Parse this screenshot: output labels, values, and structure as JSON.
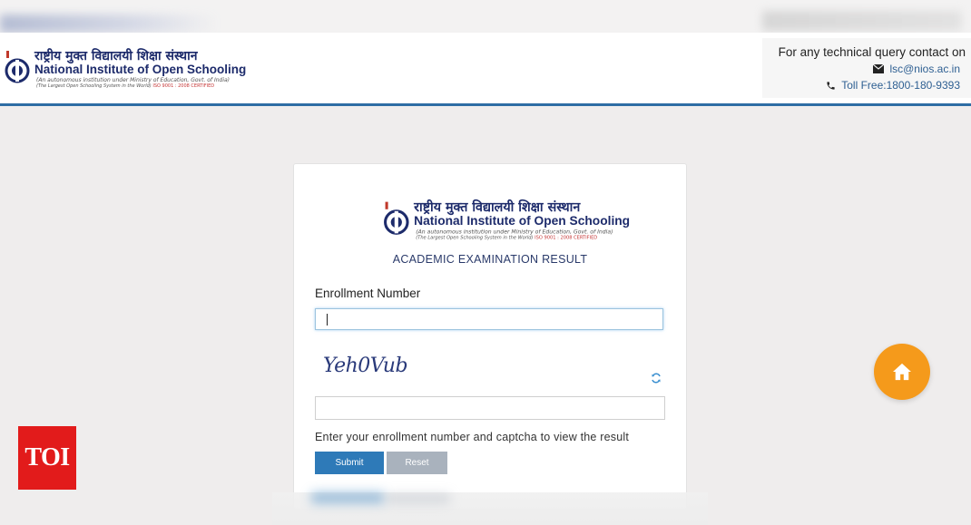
{
  "header": {
    "logo": {
      "hindi": "राष्ट्रीय मुक्त विद्यालयी शिक्षा संस्थान",
      "english": "National Institute of Open Schooling",
      "sub1": "(An autonomous institution under Ministry of Education, Govt. of India)",
      "sub2": "(The Largest Open Schooling System in the World)",
      "iso": "ISO 9001 : 2008 CERTIFIED"
    },
    "contact": {
      "title": "For any technical query contact on",
      "email": "lsc@nios.ac.in",
      "phone": "Toll Free:1800-180-9393"
    }
  },
  "card": {
    "title": "ACADEMIC EXAMINATION RESULT",
    "enrollment_label": "Enrollment Number",
    "enrollment_value": "",
    "captcha_text": "Yeh0Vub",
    "captcha_value": "",
    "help_text": "Enter your enrollment number and captcha to view the result",
    "submit_label": "Submit",
    "reset_label": "Reset"
  },
  "watermark": "TOI",
  "colors": {
    "brand_blue": "#2e6da4",
    "submit": "#2e7ab8",
    "reset": "#a9b2bd",
    "home": "#f59a1b",
    "toi": "#e21b1b"
  },
  "icons": [
    "envelope-icon",
    "phone-icon",
    "refresh-icon",
    "home-icon",
    "nios-emblem-icon"
  ]
}
